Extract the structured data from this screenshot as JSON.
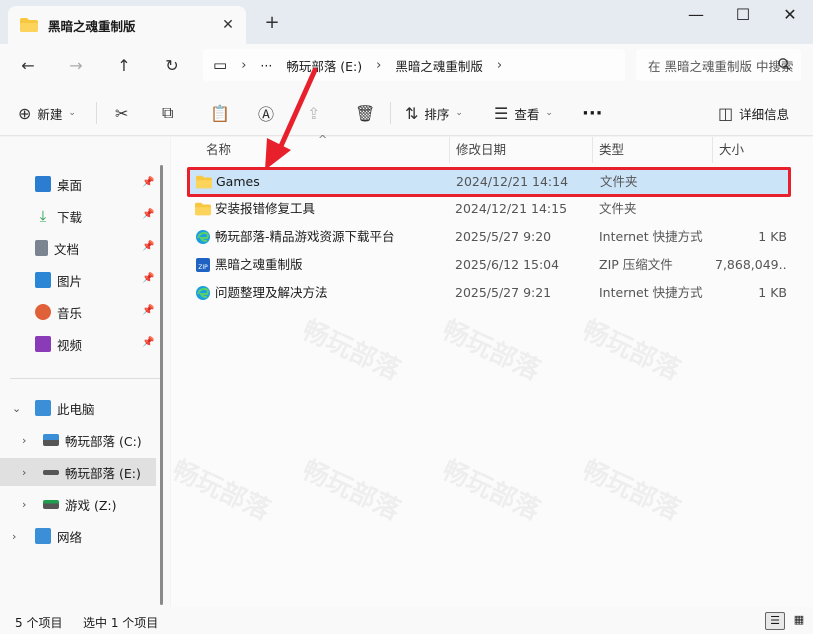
{
  "window": {
    "tab_title": "黑暗之魂重制版",
    "close_tab": "✕",
    "new_tab": "+",
    "minimize": "—",
    "maximize": "☐",
    "close": "✕"
  },
  "nav": {
    "back": "←",
    "forward": "→",
    "up": "↑",
    "refresh": "↻"
  },
  "address": {
    "computer_icon": "▭",
    "sep1": "›",
    "ellipsis": "···",
    "crumbs": [
      "畅玩部落 (E:)",
      "黑暗之魂重制版"
    ],
    "sep2": "›",
    "sep3": "›"
  },
  "search": {
    "placeholder": "在 黑暗之魂重制版 中搜索",
    "icon": "search-icon"
  },
  "toolbar": {
    "new_label": "新建",
    "sort_label": "排序",
    "view_label": "查看",
    "more": "···",
    "details_label": "详细信息"
  },
  "sidebar": {
    "quick": [
      {
        "label": "桌面",
        "color": "#2a7dd1"
      },
      {
        "label": "下载",
        "color": "#1f9e4f"
      },
      {
        "label": "文档",
        "color": "#7a8591"
      },
      {
        "label": "图片",
        "color": "#2b86d6"
      },
      {
        "label": "音乐",
        "color": "#e0603a"
      },
      {
        "label": "视频",
        "color": "#8a3bb8"
      }
    ],
    "this_pc": "此电脑",
    "drives": [
      "畅玩部落 (C:)",
      "畅玩部落 (E:)",
      "游戏 (Z:)"
    ],
    "network": "网络"
  },
  "columns": {
    "name": "名称",
    "date": "修改日期",
    "type": "类型",
    "size": "大小"
  },
  "files": [
    {
      "name": "Games",
      "date": "2024/12/21 14:14",
      "type": "文件夹",
      "size": "",
      "icon": "folder-icon"
    },
    {
      "name": "安装报错修复工具",
      "date": "2024/12/21 14:15",
      "type": "文件夹",
      "size": "",
      "icon": "folder-icon"
    },
    {
      "name": "畅玩部落-精品游戏资源下载平台",
      "date": "2025/5/27 9:20",
      "type": "Internet 快捷方式",
      "size": "1 KB",
      "icon": "edge-shortcut-icon"
    },
    {
      "name": "黑暗之魂重制版",
      "date": "2025/6/12 15:04",
      "type": "ZIP 压缩文件",
      "size": "7,868,049...",
      "icon": "zip-icon"
    },
    {
      "name": "问题整理及解决方法",
      "date": "2025/5/27 9:21",
      "type": "Internet 快捷方式",
      "size": "1 KB",
      "icon": "edge-shortcut-icon"
    }
  ],
  "status": {
    "count": "5 个项目",
    "selected": "选中 1 个项目"
  },
  "watermark": "畅玩部落",
  "accent": "#e8202c"
}
